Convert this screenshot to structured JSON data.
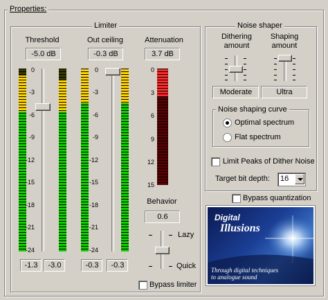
{
  "properties_title": "Properties:",
  "limiter": {
    "title": "Limiter",
    "threshold_label": "Threshold",
    "threshold_value": "-5.0 dB",
    "outceiling_label": "Out ceiling",
    "outceiling_value": "-0.3 dB",
    "attenuation_label": "Attenuation",
    "attenuation_value": "3.7 dB",
    "scale": [
      "0",
      "-3",
      "-6",
      "-9",
      "-12",
      "-15",
      "-18",
      "-21",
      "-24"
    ],
    "att_scale": [
      "0",
      "3",
      "6",
      "9",
      "12",
      "15"
    ],
    "peak_left_in": "-1.3",
    "peak_right_in": "-3.0",
    "peak_left_out": "-0.3",
    "peak_right_out": "-0.3",
    "behavior_label": "Behavior",
    "behavior_value": "0.6",
    "lazy_label": "Lazy",
    "quick_label": "Quick",
    "bypass_label": "Bypass limiter",
    "bypass_checked": false
  },
  "noise_shaper": {
    "title": "Noise shaper",
    "dithering_label_1": "Dithering",
    "dithering_label_2": "amount",
    "dithering_value": "Moderate",
    "shaping_label_1": "Shaping",
    "shaping_label_2": "amount",
    "shaping_value": "Ultra",
    "curve_title": "Noise shaping curve",
    "curve_options": [
      {
        "label": "Optimal spectrum",
        "selected": true
      },
      {
        "label": "Flat spectrum",
        "selected": false
      }
    ],
    "limit_peaks_label": "Limit Peaks of Dither Noise",
    "limit_peaks_checked": false,
    "target_bit_depth_label": "Target bit depth:",
    "target_bit_depth_value": "16"
  },
  "bypass_quantization_label": "Bypass quantization",
  "bypass_quantization_checked": false,
  "logo": {
    "title_1": "Digital",
    "title_2": "Illusions",
    "tagline_1": "Through digital techniques",
    "tagline_2": "to analogue sound"
  }
}
